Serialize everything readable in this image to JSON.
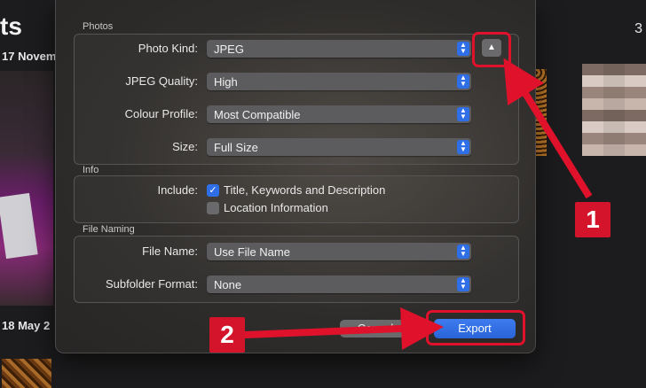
{
  "background": {
    "title": "ts",
    "date_top": "17 Novem",
    "date_bottom": "18 May 2",
    "count": "3"
  },
  "dialog": {
    "photos_section": {
      "label": "Photos",
      "rows": [
        {
          "label": "Photo Kind:",
          "value": "JPEG"
        },
        {
          "label": "JPEG Quality:",
          "value": "High"
        },
        {
          "label": "Colour Profile:",
          "value": "Most Compatible"
        },
        {
          "label": "Size:",
          "value": "Full Size"
        }
      ],
      "disclosure_icon": "chevron-up-icon"
    },
    "info_section": {
      "label": "Info",
      "include_label": "Include:",
      "options": [
        {
          "label": "Title, Keywords and Description",
          "checked": true
        },
        {
          "label": "Location Information",
          "checked": false
        }
      ]
    },
    "naming_section": {
      "label": "File Naming",
      "rows": [
        {
          "label": "File Name:",
          "value": "Use File Name"
        },
        {
          "label": "Subfolder Format:",
          "value": "None"
        }
      ]
    },
    "buttons": {
      "cancel": "Cancel",
      "export": "Export"
    }
  },
  "annotations": {
    "badge_1": "1",
    "badge_2": "2",
    "color": "#e0112b"
  }
}
